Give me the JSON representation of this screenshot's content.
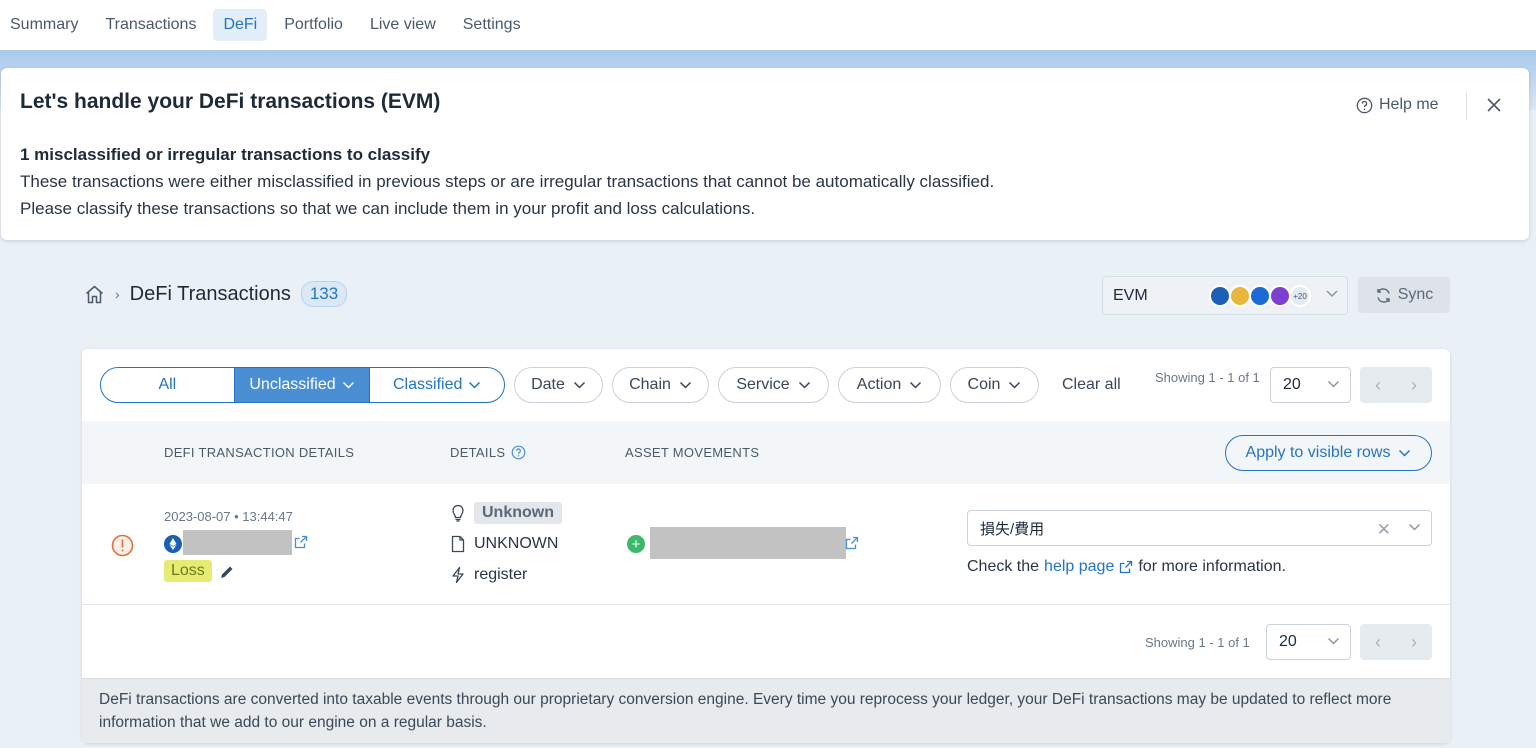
{
  "nav": {
    "tabs": [
      "Summary",
      "Transactions",
      "DeFi",
      "Portfolio",
      "Live view",
      "Settings"
    ],
    "active": "DeFi"
  },
  "banner": {
    "title": "Let's handle your DeFi transactions (EVM)",
    "help_label": "Help me",
    "heading": "1 misclassified or irregular transactions to classify",
    "line1": "These transactions were either misclassified in previous steps or are irregular transactions that cannot be automatically classified.",
    "line2": "Please classify these transactions so that we can include them in your profit and loss calculations."
  },
  "breadcrumb": {
    "title": "DeFi Transactions",
    "count": "133"
  },
  "chain_selector": {
    "label": "EVM",
    "more": "+20",
    "coin_colors": [
      "#1b5fb8",
      "#e9b63c",
      "#1b6ad6",
      "#7d3fd0"
    ]
  },
  "sync_label": "Sync",
  "filters": {
    "segments": [
      "All",
      "Unclassified",
      "Classified"
    ],
    "active_segment": "Unclassified",
    "pills": [
      "Date",
      "Chain",
      "Service",
      "Action",
      "Coin"
    ],
    "clear_all": "Clear all"
  },
  "pagination": {
    "showing_top": "Showing 1 - 1 of 1",
    "showing_bottom": "Showing 1 - 1 of 1",
    "page_size": "20"
  },
  "table": {
    "headers": {
      "details_col": "DEFI TRANSACTION DETAILS",
      "details": "DETAILS",
      "assets": "ASSET MOVEMENTS"
    },
    "apply_label": "Apply to visible rows",
    "row": {
      "datetime": "2023-08-07 • 13:44:47",
      "tag": "Loss",
      "type": "Unknown",
      "kind": "UNKNOWN",
      "action": "register",
      "classification": "損失/費用",
      "hint_prefix": "Check the",
      "hint_link": "help page",
      "hint_suffix": "for more information."
    }
  },
  "footer_text": "DeFi transactions are converted into taxable events through our proprietary conversion engine. Every time you reprocess your ledger, your DeFi transactions may be updated to reflect more information that we add to our engine on a regular basis."
}
